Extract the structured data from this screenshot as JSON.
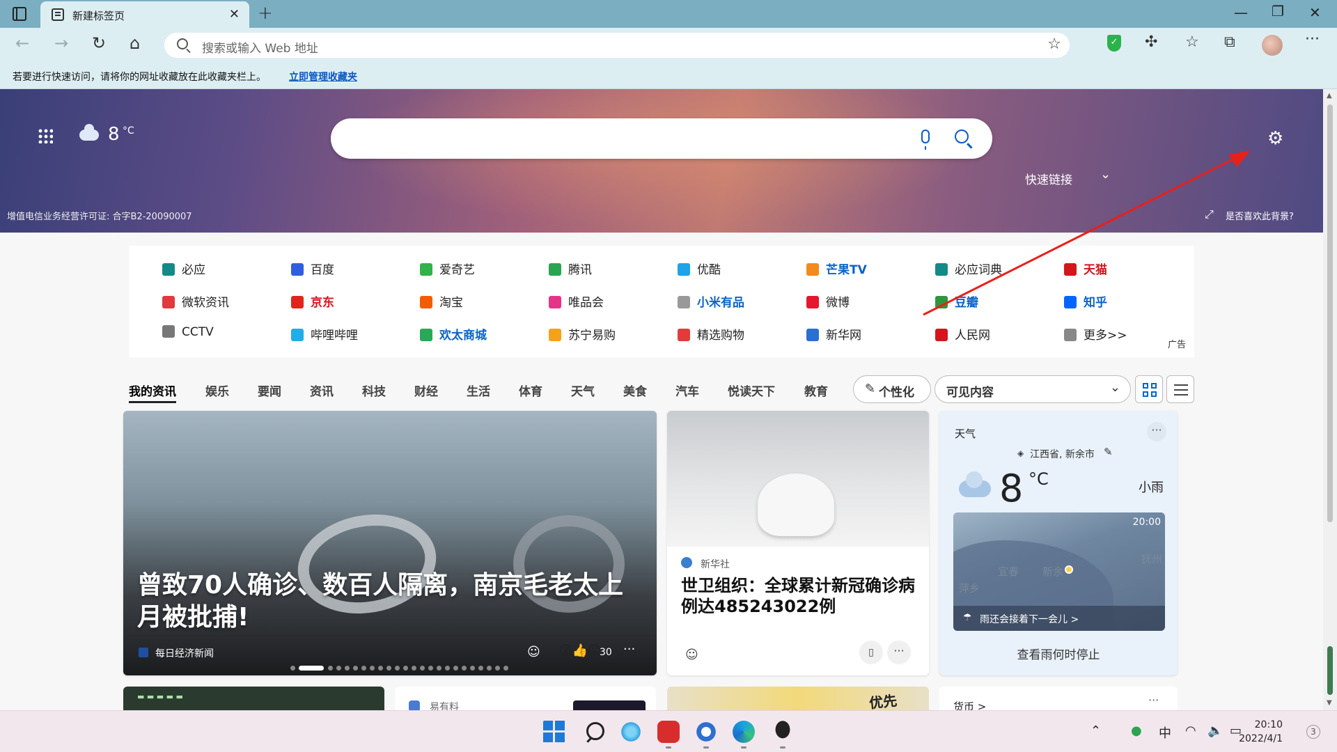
{
  "tab": {
    "title": "新建标签页"
  },
  "address_bar": {
    "placeholder": "搜索或输入 Web 地址"
  },
  "favorites_bar": {
    "message": "若要进行快速访问，请将你的网址收藏放在此收藏夹栏上。",
    "link": "立即管理收藏夹"
  },
  "hero": {
    "temperature": "8",
    "unit": "°C",
    "quick_links_label": "快速链接",
    "license": "增值电信业务经营许可证: 合字B2-20090007",
    "like_background": "是否喜欢此背景?"
  },
  "quick_links": {
    "items": [
      {
        "label": "必应",
        "icon": "bing-icon",
        "color": "#138a87"
      },
      {
        "label": "百度",
        "icon": "baidu-icon",
        "color": "#2f5fe0"
      },
      {
        "label": "爱奇艺",
        "icon": "iqiyi-icon",
        "color": "#33b14a"
      },
      {
        "label": "腾讯",
        "icon": "tencent-icon",
        "color": "#2aa44f"
      },
      {
        "label": "优酷",
        "icon": "youku-icon",
        "color": "#1fa3e8"
      },
      {
        "label": "芒果TV",
        "icon": "mangotv-icon",
        "color": "#f28a1c"
      },
      {
        "label": "必应词典",
        "icon": "bing-dict-icon",
        "color": "#138a87"
      },
      {
        "label": "天猫",
        "icon": "tmall-icon",
        "color": "#d4161c"
      },
      {
        "label": "微软资讯",
        "icon": "msn-icon",
        "color": "#e0393e"
      },
      {
        "label": "京东",
        "icon": "jd-icon",
        "color": "#e1251b"
      },
      {
        "label": "淘宝",
        "icon": "taobao-icon",
        "color": "#f25c05"
      },
      {
        "label": "唯品会",
        "icon": "vip-icon",
        "color": "#e6338a"
      },
      {
        "label": "小米有品",
        "icon": "youpin-icon",
        "color": "#999999"
      },
      {
        "label": "微博",
        "icon": "weibo-icon",
        "color": "#e6162d"
      },
      {
        "label": "豆瓣",
        "icon": "douban-icon",
        "color": "#2e963d"
      },
      {
        "label": "知乎",
        "icon": "zhihu-icon",
        "color": "#0066ff"
      },
      {
        "label": "CCTV",
        "icon": "cctv-icon",
        "color": "#777777"
      },
      {
        "label": "哔哩哔哩",
        "icon": "bilibili-icon",
        "color": "#23ade5"
      },
      {
        "label": "欢太商城",
        "icon": "heytap-icon",
        "color": "#2aa85a"
      },
      {
        "label": "苏宁易购",
        "icon": "suning-icon",
        "color": "#f4a21b"
      },
      {
        "label": "精选购物",
        "icon": "shopping-icon",
        "color": "#e23b3b"
      },
      {
        "label": "新华网",
        "icon": "xinhua-icon",
        "color": "#2b6fd0"
      },
      {
        "label": "人民网",
        "icon": "people-icon",
        "color": "#d4161c"
      },
      {
        "label": "更多>>",
        "icon": "more-icon",
        "color": "#888888"
      }
    ],
    "ad_label": "广告"
  },
  "news_nav": {
    "tabs": [
      "我的资讯",
      "娱乐",
      "要闻",
      "资讯",
      "科技",
      "财经",
      "生活",
      "体育",
      "天气",
      "美食",
      "汽车",
      "悦读天下",
      "教育"
    ],
    "personalize": "个性化",
    "visible_content": "可见内容"
  },
  "main_card": {
    "headline": "曾致70人确诊、数百人隔离，南京毛老太上月被批捕!",
    "source": "每日经济新闻",
    "reaction_count": "30",
    "carousel_count": 24
  },
  "who_card": {
    "source": "新华社",
    "headline": "世卫组织：全球累计新冠确诊病例达485243022例"
  },
  "weather_card": {
    "title": "天气",
    "location": "江西省, 新余市",
    "temperature": "8",
    "unit": "°C",
    "condition": "小雨",
    "map_time": "20:00",
    "cities": [
      "宜春",
      "新余",
      "抚州",
      "萍乡"
    ],
    "rain_message": "雨还会接着下一会儿 >",
    "link": "查看雨何时停止"
  },
  "bottom_cards": {
    "card2_source": "易有料",
    "card3_text": "优先",
    "card4_title": "货币 >"
  },
  "taskbar": {
    "ime": "中",
    "time": "20:10",
    "date": "2022/4/1",
    "badge": "3"
  }
}
